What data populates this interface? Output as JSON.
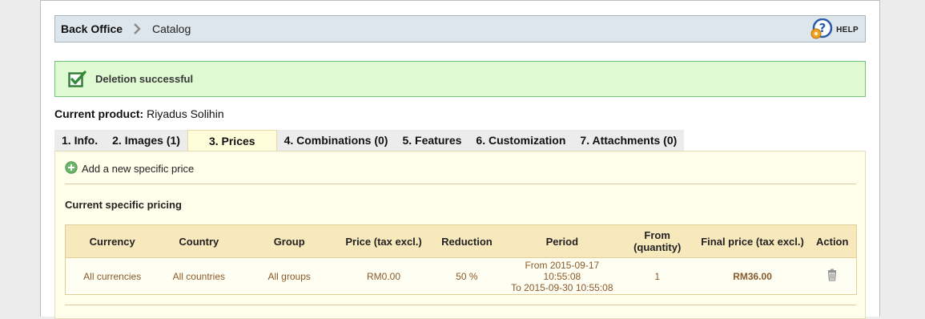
{
  "breadcrumb": {
    "home": "Back Office",
    "current": "Catalog"
  },
  "help": {
    "label": "HELP"
  },
  "alert": {
    "message": "Deletion successful"
  },
  "product": {
    "label": "Current product:",
    "name": "Riyadus Solihin"
  },
  "tabs": [
    {
      "label": "1. Info."
    },
    {
      "label": "2. Images (1)"
    },
    {
      "label": "3. Prices",
      "active": true
    },
    {
      "label": "4. Combinations (0)"
    },
    {
      "label": "5. Features"
    },
    {
      "label": "6. Customization"
    },
    {
      "label": "7. Attachments (0)"
    }
  ],
  "prices": {
    "add_link": "Add a new specific price",
    "section_title": "Current specific pricing",
    "headers": {
      "currency": "Currency",
      "country": "Country",
      "group": "Group",
      "price": "Price (tax excl.)",
      "reduction": "Reduction",
      "period": "Period",
      "from_qty": "From (quantity)",
      "final_price": "Final price (tax excl.)",
      "action": "Action"
    },
    "rows": [
      {
        "currency": "All currencies",
        "country": "All countries",
        "group": "All groups",
        "price": "RM0.00",
        "reduction": "50 %",
        "period_from": "From 2015-09-17 10:55:08",
        "period_to": "To 2015-09-30 10:55:08",
        "from_qty": "1",
        "final_price": "RM36.00"
      }
    ]
  },
  "colors": {
    "breadcrumb_bg": "#dde6ec",
    "success_bg": "#dffad3",
    "success_border": "#72c279",
    "panel_bg": "#fffeeb",
    "table_header_bg": "#f8e9bd",
    "cell_text": "#8a5a2b"
  },
  "icons": {
    "breadcrumb_separator": "chevron-right-icon",
    "help": "help-icon",
    "success": "checkbox-checked-icon",
    "add": "add-circle-icon",
    "delete": "trash-icon"
  }
}
